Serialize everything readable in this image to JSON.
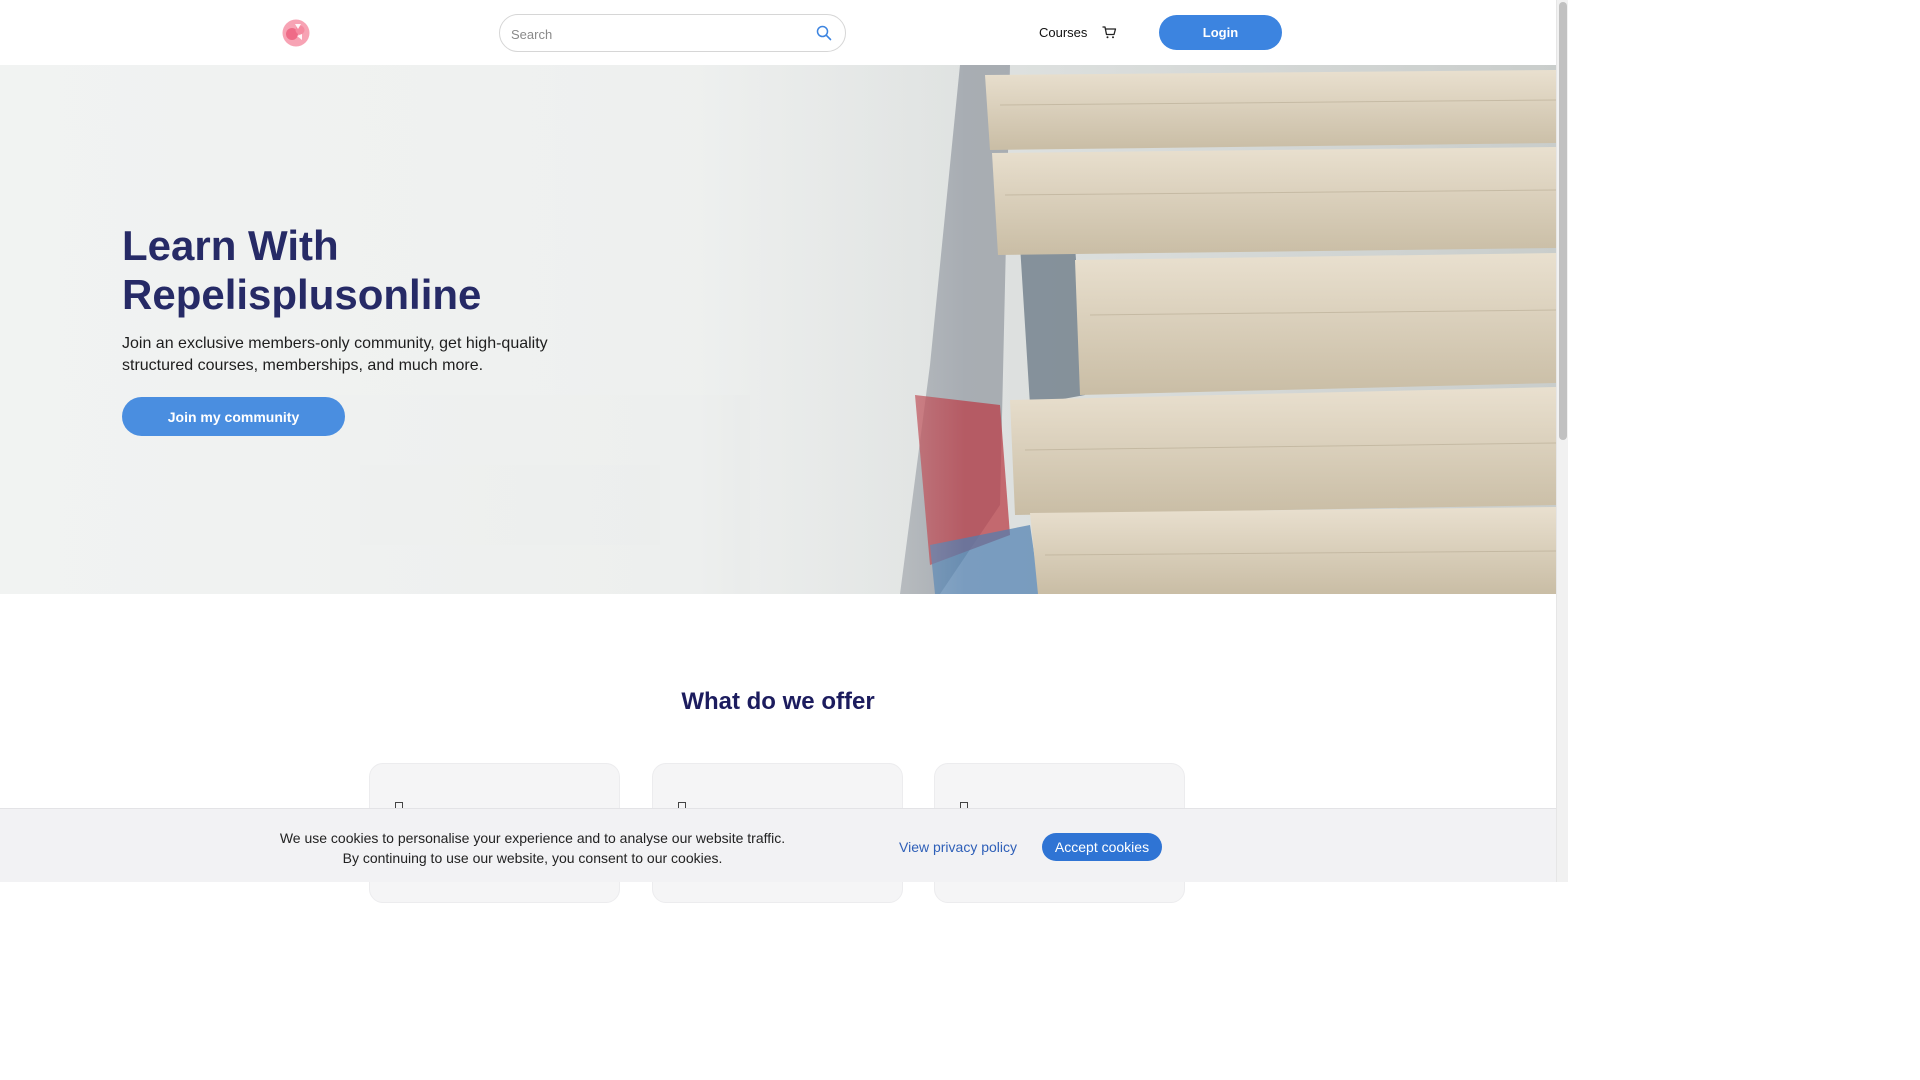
{
  "header": {
    "search_placeholder": "Search",
    "nav_courses": "Courses",
    "login_label": "Login"
  },
  "hero": {
    "title": "Learn With Repelisplusonline",
    "subtitle": "Join an exclusive members-only community, get high-quality structured courses, memberships, and much more.",
    "cta_label": "Join my community"
  },
  "offer": {
    "title": "What do we offer",
    "cards": [
      {
        "icon": "feature-icon"
      },
      {
        "icon": "feature-icon"
      },
      {
        "icon": "feature-icon"
      }
    ]
  },
  "cookie": {
    "line1": "We use cookies to personalise your experience and to analyse our website traffic.",
    "line2": "By continuing to use our website, you consent to our cookies.",
    "privacy_label": "View privacy policy",
    "accept_label": "Accept cookies"
  },
  "colors": {
    "accent": "#3c84e0",
    "heading": "#262a66",
    "section_heading": "#1c1c5e"
  }
}
